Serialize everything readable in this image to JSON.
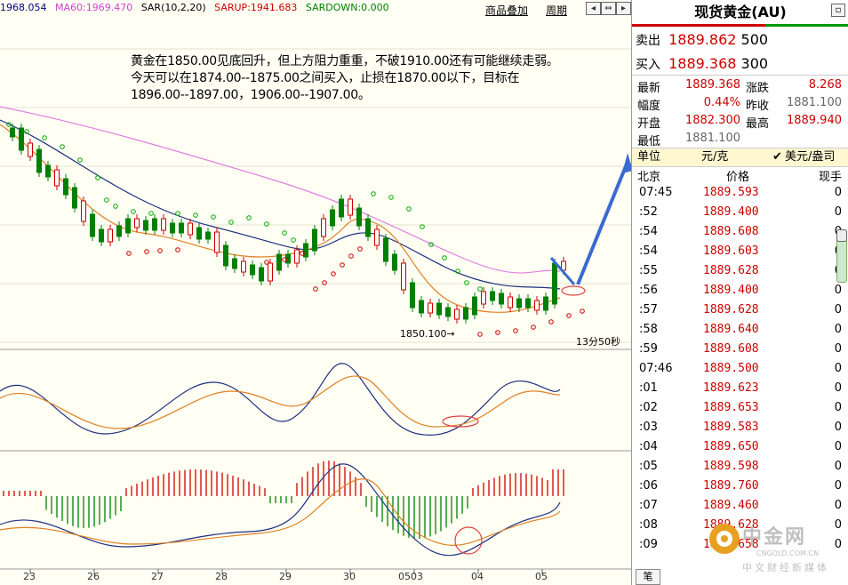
{
  "legend": {
    "ma_last": "1968.054",
    "ma60": "MA60:1969.470",
    "sar": "SAR(10,2,20)",
    "sarup": "SARUP:1941.683",
    "sardown": "SARDOWN:0.000"
  },
  "toolbar": {
    "overlay": "商品叠加",
    "period": "周期"
  },
  "commentary": {
    "line1": "黄金在1850.00见底回升，但上方阻力重重，不破1910.00还有可能继续走弱。",
    "line2": "今天可以在1874.00--1875.00之间买入，止损在1870.00以下，目标在",
    "line3": "1896.00--1897.00，1906.00--1907.00。"
  },
  "annotations": {
    "low": "1850.100→",
    "countdown": "13分50秒"
  },
  "x_labels": [
    "23",
    "26",
    "27",
    "28",
    "29",
    "30",
    "0503",
    "04",
    "05"
  ],
  "quote": {
    "title": "现货黄金(AU)",
    "sell_label": "卖出",
    "sell_price": "1889.862",
    "sell_vol": "500",
    "buy_label": "买入",
    "buy_price": "1889.368",
    "buy_vol": "300",
    "stats": [
      {
        "k": "最新",
        "v": "1889.368",
        "k2": "涨跌",
        "v2": "8.268"
      },
      {
        "k": "幅度",
        "v": "0.44%",
        "k2": "昨收",
        "v2": "1881.100"
      },
      {
        "k": "开盘",
        "v": "1882.300",
        "k2": "最高",
        "v2": "1889.940"
      },
      {
        "k": "最低",
        "v": "1881.100"
      }
    ],
    "unit_label": "单位",
    "unit_value": "元/克",
    "unit_alt": "美元/盎司",
    "col_time": "北京",
    "col_price": "价格",
    "col_vol": "现手",
    "ticks": [
      {
        "t": "07:45",
        "p": "1889.593",
        "v": "0"
      },
      {
        "t": ":52",
        "p": "1889.400",
        "v": "0"
      },
      {
        "t": ":54",
        "p": "1889.608",
        "v": "0"
      },
      {
        "t": ":54",
        "p": "1889.603",
        "v": "0"
      },
      {
        "t": ":55",
        "p": "1889.628",
        "v": "0"
      },
      {
        "t": ":56",
        "p": "1889.400",
        "v": "0"
      },
      {
        "t": ":57",
        "p": "1889.628",
        "v": "0"
      },
      {
        "t": ":58",
        "p": "1889.640",
        "v": "0"
      },
      {
        "t": ":59",
        "p": "1889.608",
        "v": "0"
      },
      {
        "t": "07:46",
        "p": "1889.500",
        "v": "0"
      },
      {
        "t": ":01",
        "p": "1889.623",
        "v": "0"
      },
      {
        "t": ":02",
        "p": "1889.653",
        "v": "0"
      },
      {
        "t": ":03",
        "p": "1889.583",
        "v": "0"
      },
      {
        "t": ":04",
        "p": "1889.650",
        "v": "0"
      },
      {
        "t": ":05",
        "p": "1889.598",
        "v": "0"
      },
      {
        "t": ":06",
        "p": "1889.760",
        "v": "0"
      },
      {
        "t": ":07",
        "p": "1889.460",
        "v": "0"
      },
      {
        "t": ":08",
        "p": "1889.628",
        "v": "0"
      },
      {
        "t": ":09",
        "p": "1889.658",
        "v": "0"
      }
    ],
    "bottom_tab": "笔"
  },
  "watermark": {
    "name": "中金网",
    "url": "CNGOLD.COM.CN",
    "sub": "中文财经新媒体"
  },
  "colors": {
    "up": "#cc0000",
    "down": "#008000",
    "accent_blue": "#3a6bd1"
  }
}
